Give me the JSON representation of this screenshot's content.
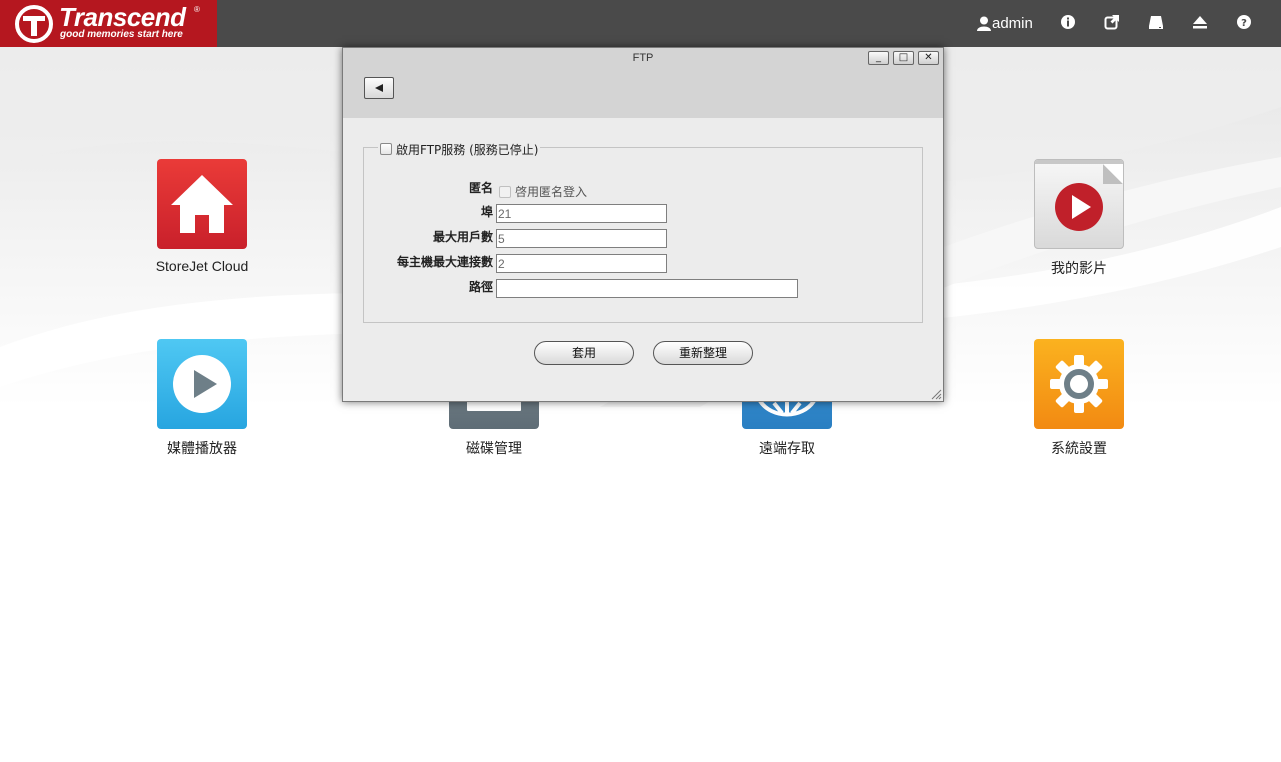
{
  "brand": {
    "name": "Transcend",
    "registered": "®",
    "tagline": "good memories start here",
    "color": "#b5171f"
  },
  "topbar": {
    "user_label": "admin",
    "icons": [
      "user-icon",
      "info-icon",
      "external-link-icon",
      "drive-icon",
      "eject-icon",
      "help-icon"
    ],
    "background": "#4a4a4a"
  },
  "apps": [
    {
      "label": "StoreJet Cloud",
      "icon": "home-icon",
      "color": "#d9272e"
    },
    {
      "label": "媒體播放器",
      "icon": "play-icon",
      "color": "#35b4ea"
    },
    {
      "label": "磁碟管理",
      "icon": "disk-icon",
      "color": "#6d7b84"
    },
    {
      "label": "遠端存取",
      "icon": "globe-icon",
      "color": "#2f86c9"
    },
    {
      "label": "我的影片",
      "icon": "video-icon",
      "color": "#c0202a"
    },
    {
      "label": "系統設置",
      "icon": "gear-icon",
      "color": "#f59a16"
    }
  ],
  "dialog": {
    "title": "FTP",
    "window_buttons": {
      "minimize": "_",
      "maximize": "□",
      "close": "✕"
    },
    "back_icon": "back-arrow-icon",
    "enable_label": "啟用FTP服務 (服務已停止)",
    "enable_checked": false,
    "fields": {
      "anonymous_label": "匿名",
      "anonymous_option": "啓用匿名登入",
      "port_label": "埠",
      "port_value": "21",
      "max_users_label": "最大用戶數",
      "max_users_value": "5",
      "max_conn_label": "每主機最大連接數",
      "max_conn_value": "2",
      "path_label": "路徑",
      "path_value": ""
    },
    "apply_label": "套用",
    "refresh_label": "重新整理"
  }
}
